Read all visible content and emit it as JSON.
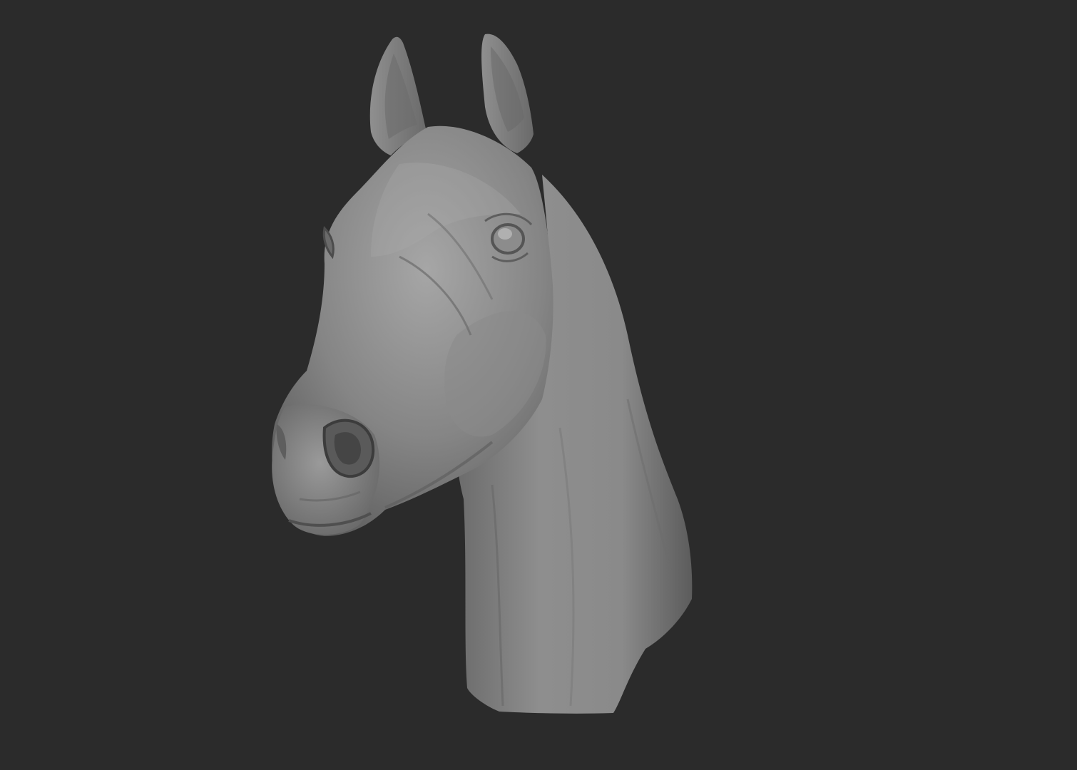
{
  "scene": {
    "background_color": "#2b2b2b",
    "model_base_color": "#7a7a7a",
    "model_light_color": "#a3a3a3",
    "model_shadow_color": "#4a4a4a",
    "subject": "horse-head-sculpt"
  }
}
